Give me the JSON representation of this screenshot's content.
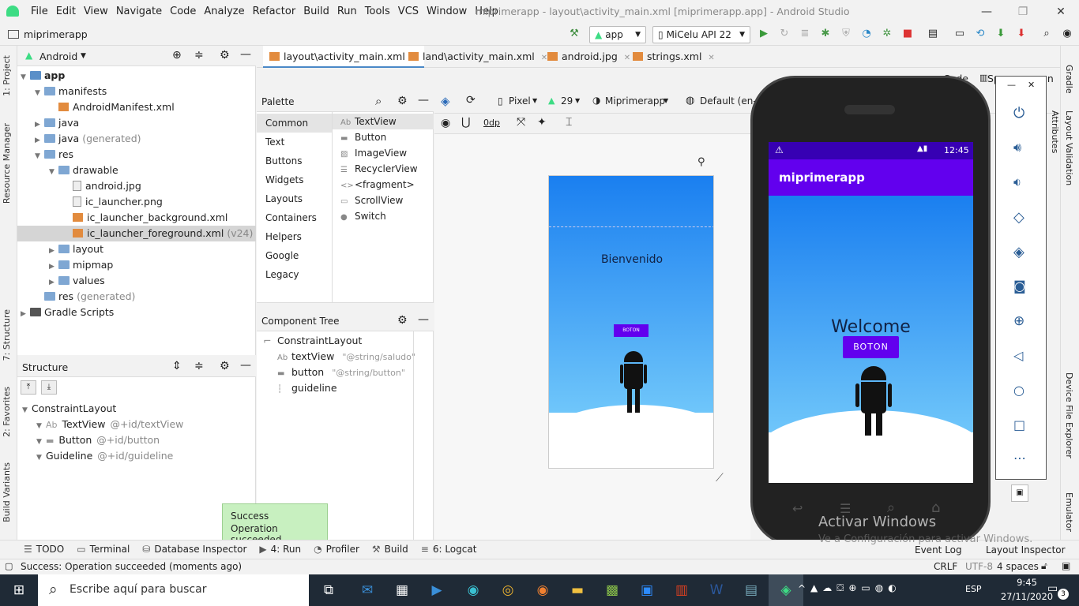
{
  "window": {
    "title": "miprimerapp - layout\\activity_main.xml [miprimerapp.app] - Android Studio",
    "menu": [
      "File",
      "Edit",
      "View",
      "Navigate",
      "Code",
      "Analyze",
      "Refactor",
      "Build",
      "Run",
      "Tools",
      "VCS",
      "Window",
      "Help"
    ]
  },
  "navbar": {
    "project": "miprimerapp",
    "run_config": "app",
    "device": "MiCelu API 22"
  },
  "left_tabs": [
    "1: Project",
    "Resource Manager",
    "7: Structure",
    "2: Favorites",
    "Build Variants"
  ],
  "project_panel": {
    "view": "Android",
    "items": [
      {
        "label": "app",
        "level": 0,
        "type": "module",
        "arrow": "▼"
      },
      {
        "label": "manifests",
        "level": 1,
        "type": "folder",
        "arrow": "▼"
      },
      {
        "label": "AndroidManifest.xml",
        "level": 2,
        "type": "manifest",
        "arrow": ""
      },
      {
        "label": "java",
        "level": 1,
        "type": "folder",
        "arrow": "▶"
      },
      {
        "label": "java",
        "suffix": "(generated)",
        "level": 1,
        "type": "folder",
        "arrow": "▶"
      },
      {
        "label": "res",
        "level": 1,
        "type": "folder",
        "arrow": "▼"
      },
      {
        "label": "drawable",
        "level": 2,
        "type": "folder",
        "arrow": "▼"
      },
      {
        "label": "android.jpg",
        "level": 3,
        "type": "image",
        "arrow": ""
      },
      {
        "label": "ic_launcher.png",
        "level": 3,
        "type": "image",
        "arrow": ""
      },
      {
        "label": "ic_launcher_background.xml",
        "level": 3,
        "type": "xml",
        "arrow": ""
      },
      {
        "label": "ic_launcher_foreground.xml",
        "suffix": "(v24)",
        "level": 3,
        "type": "xml",
        "arrow": "",
        "selected": true
      },
      {
        "label": "layout",
        "level": 2,
        "type": "folder",
        "arrow": "▶"
      },
      {
        "label": "mipmap",
        "level": 2,
        "type": "folder",
        "arrow": "▶"
      },
      {
        "label": "values",
        "level": 2,
        "type": "folder",
        "arrow": "▶"
      },
      {
        "label": "res",
        "suffix": "(generated)",
        "level": 1,
        "type": "folder",
        "arrow": ""
      },
      {
        "label": "Gradle Scripts",
        "level": 0,
        "type": "gradle",
        "arrow": "▶"
      }
    ]
  },
  "structure_panel": {
    "title": "Structure",
    "items": [
      {
        "label": "ConstraintLayout",
        "id": "",
        "level": 0
      },
      {
        "label": "TextView",
        "id": "@+id/textView",
        "level": 1,
        "prefix": "Ab"
      },
      {
        "label": "Button",
        "id": "@+id/button",
        "level": 1,
        "prefix": "▬"
      },
      {
        "label": "Guideline",
        "id": "@+id/guideline",
        "level": 1,
        "prefix": ""
      }
    ]
  },
  "editor_tabs": [
    {
      "label": "layout\\activity_main.xml",
      "active": true
    },
    {
      "label": "land\\activity_main.xml",
      "active": false
    },
    {
      "label": "android.jpg",
      "active": false
    },
    {
      "label": "strings.xml",
      "active": false
    }
  ],
  "view_modes": [
    "Code",
    "Sp",
    "gn"
  ],
  "palette": {
    "title": "Palette",
    "categories": [
      "Common",
      "Text",
      "Buttons",
      "Widgets",
      "Layouts",
      "Containers",
      "Helpers",
      "Google",
      "Legacy"
    ],
    "widgets": [
      {
        "icon": "Ab",
        "label": "TextView"
      },
      {
        "icon": "▬",
        "label": "Button"
      },
      {
        "icon": "▨",
        "label": "ImageView"
      },
      {
        "icon": "☰",
        "label": "RecyclerView"
      },
      {
        "icon": "<>",
        "label": "<fragment>"
      },
      {
        "icon": "▭",
        "label": "ScrollView"
      },
      {
        "icon": "●",
        "label": "Switch"
      }
    ]
  },
  "design_toolbar": {
    "device": "Pixel",
    "api": "29",
    "theme": "Miprimerapp",
    "locale": "Default (en-us)",
    "margin": "0dp"
  },
  "component_tree": {
    "title": "Component Tree",
    "items": [
      {
        "label": "ConstraintLayout",
        "detail": "",
        "level": 0
      },
      {
        "label": "textView",
        "detail": "\"@string/saludo\"",
        "level": 1,
        "prefix": "Ab"
      },
      {
        "label": "button",
        "detail": "\"@string/button\"",
        "level": 1,
        "prefix": "▬"
      },
      {
        "label": "guideline",
        "detail": "",
        "level": 1,
        "prefix": "┆"
      }
    ]
  },
  "design_preview": {
    "text": "Bienvenido",
    "button": "BOTON"
  },
  "emulator": {
    "time": "12:45",
    "app_title": "miprimerapp",
    "text": "Welcome",
    "button": "BOTON",
    "app_bar_color": "#6200ee"
  },
  "right_tabs": [
    "Gradle",
    "Attributes",
    "Layout Validation",
    "Device File Explorer",
    "Emulator"
  ],
  "toast": {
    "title": "Success",
    "message": "Operation succeeded"
  },
  "bottom_tools": [
    {
      "icon": "☰",
      "label": "TODO"
    },
    {
      "icon": "▭",
      "label": "Terminal"
    },
    {
      "icon": "⛁",
      "label": "Database Inspector"
    },
    {
      "icon": "▶",
      "label": "4: Run"
    },
    {
      "icon": "◔",
      "label": "Profiler"
    },
    {
      "icon": "⚒",
      "label": "Build"
    },
    {
      "icon": "≡",
      "label": "6: Logcat"
    }
  ],
  "bottom_right_tools": [
    "Event Log",
    "Layout Inspector"
  ],
  "watermark": {
    "title": "Activar Windows",
    "subtitle": "Ve a Configuración para activar Windows."
  },
  "status": {
    "message": "Success: Operation succeeded (moments ago)",
    "line_sep": "CRLF",
    "encoding": "UTF-8",
    "indent": "4 spaces"
  },
  "taskbar": {
    "search": "Escribe aquí para buscar",
    "lang": "ESP",
    "time": "9:45",
    "date": "27/11/2020",
    "notifications": "3"
  }
}
